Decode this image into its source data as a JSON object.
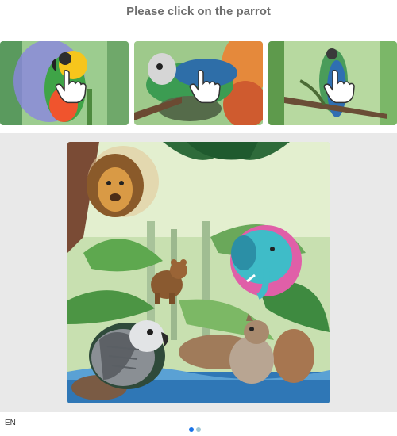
{
  "prompt": "Please click on the parrot",
  "examples": [
    {
      "subject": "parrot",
      "icon": "hand-pointer-icon"
    },
    {
      "subject": "parrot",
      "icon": "hand-pointer-icon"
    },
    {
      "subject": "parrot",
      "icon": "hand-pointer-icon"
    }
  ],
  "scene": {
    "animals": [
      "lion",
      "elephant",
      "bear",
      "parrot",
      "squirrel"
    ]
  },
  "footer": {
    "language": "EN",
    "page_indicator": {
      "current": 1,
      "total": 2
    }
  },
  "colors": {
    "panel_bg": "#e9e9e9",
    "prompt_text": "#6e6e6e",
    "dot_active": "#1a73e8",
    "dot_inactive": "#9fc7d4"
  }
}
